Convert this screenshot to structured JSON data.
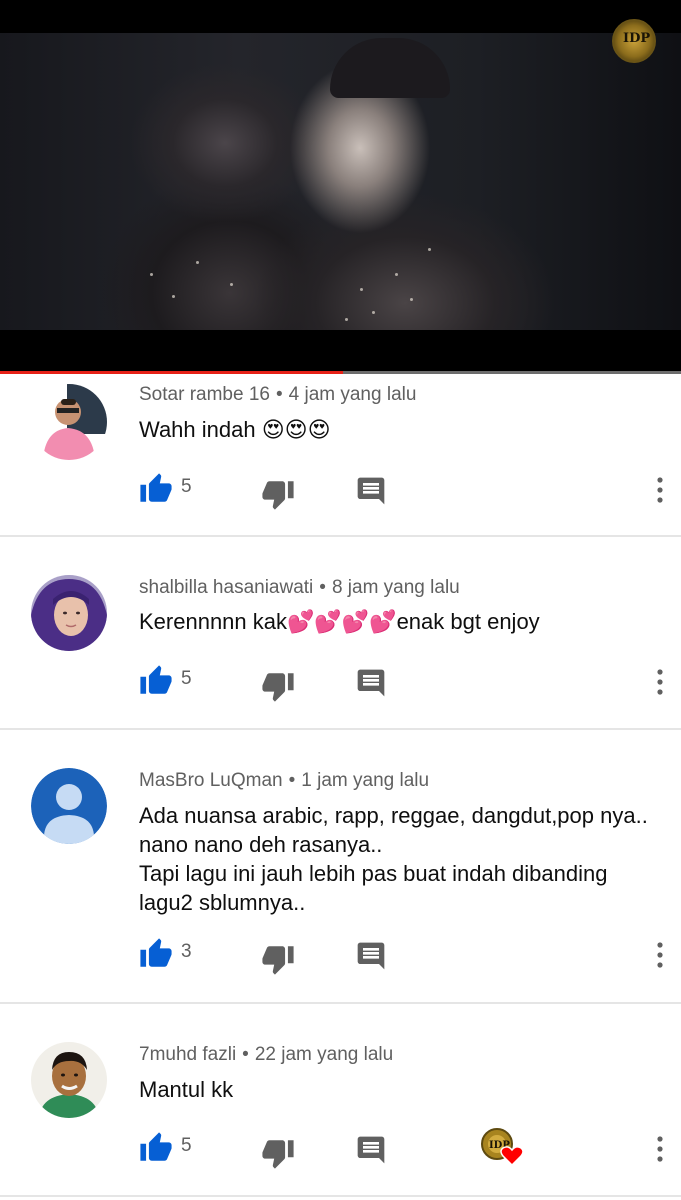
{
  "video": {
    "progress_fraction": 0.503,
    "colors": {
      "progress_played": "#e62117",
      "progress_track": "#6d6d6d"
    }
  },
  "colors": {
    "like_blue": "#065fd4",
    "icon_gray": "#606060",
    "heart_red": "#ff0000"
  },
  "comments": [
    {
      "author": "Sotar rambe 16",
      "time": "4 jam yang lalu",
      "text": "Wahh indah 😍😍😍",
      "likes": "5",
      "avatar_icon": "photo-avatar",
      "creator_heart": false
    },
    {
      "author": "shalbilla hasaniawati",
      "time": "8 jam yang lalu",
      "text": "Kerennnnn kak💕💕💕💕enak bgt enjoy",
      "likes": "5",
      "avatar_icon": "photo-avatar",
      "creator_heart": false
    },
    {
      "author": "MasBro LuQman",
      "time": "1 jam yang lalu",
      "text": "Ada nuansa arabic, rapp, reggae, dangdut,pop nya..\nnano nano deh rasanya..\nTapi lagu ini jauh lebih pas buat indah dibanding\nlagu2 sblumnya..",
      "likes": "3",
      "avatar_icon": "default-person-avatar",
      "creator_heart": false
    },
    {
      "author": "7muhd fazli",
      "time": "22 jam yang lalu",
      "text": "Mantul kk",
      "likes": "5",
      "avatar_icon": "photo-avatar",
      "creator_heart": true
    }
  ],
  "icons": [
    "thumbs-up-icon",
    "thumbs-down-icon",
    "reply-icon",
    "more-vert-icon",
    "creator-heart-icon"
  ],
  "meta_separator": "•"
}
